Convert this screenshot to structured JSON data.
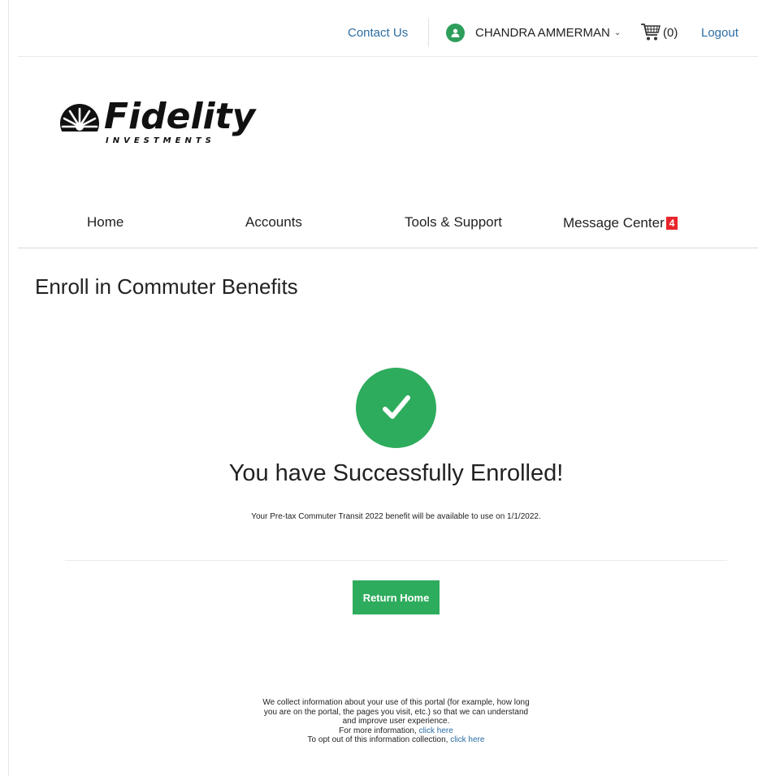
{
  "header": {
    "contact_label": "Contact Us",
    "user_name": "CHANDRA AMMERMAN",
    "cart_count": "(0)",
    "logout_label": "Logout"
  },
  "logo": {
    "wordmark": "Fidelity",
    "subtitle": "INVESTMENTS"
  },
  "nav": {
    "items": [
      {
        "label": "Home"
      },
      {
        "label": "Accounts"
      },
      {
        "label": "Tools & Support"
      },
      {
        "label": "Message Center",
        "badge": "4"
      }
    ]
  },
  "main": {
    "page_title": "Enroll in Commuter Benefits",
    "success_title": "You have Successfully Enrolled!",
    "success_message": "Your Pre-tax Commuter Transit  2022 benefit will be available to use on 1/1/2022.",
    "return_button": "Return Home"
  },
  "footer": {
    "line1": "We collect information about your use of this portal (for example, how long",
    "line2": "you are on the portal, the pages you visit, etc.) so that we can understand",
    "line3": "and improve user experience.",
    "line4_prefix": "For more information, ",
    "line4_link": "click here",
    "line5_prefix": "To opt out of this information collection, ",
    "line5_link": "click here"
  },
  "colors": {
    "accent_green": "#2eac5d",
    "link_blue": "#2b6da3",
    "badge_red": "#e8252a"
  }
}
